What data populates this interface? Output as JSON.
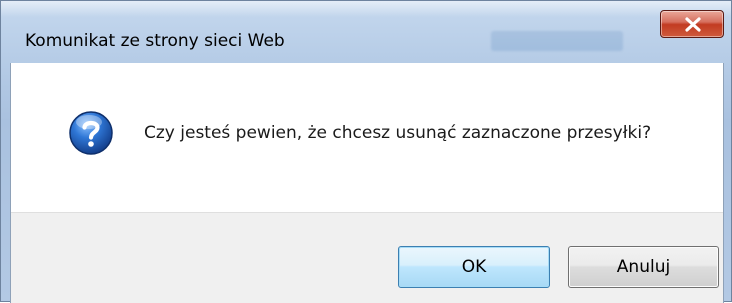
{
  "window": {
    "title": "Komunikat ze strony sieci Web",
    "close_icon": "close-x-icon"
  },
  "message": {
    "icon": "question-icon",
    "text": "Czy jesteś pewien, że chcesz usunąć zaznaczone przesyłki?"
  },
  "buttons": {
    "ok_label": "OK",
    "cancel_label": "Anuluj"
  },
  "colors": {
    "close_button": "#c23b22",
    "question_icon": "#1f5fb7",
    "ok_button_border": "#3c7fb1"
  }
}
